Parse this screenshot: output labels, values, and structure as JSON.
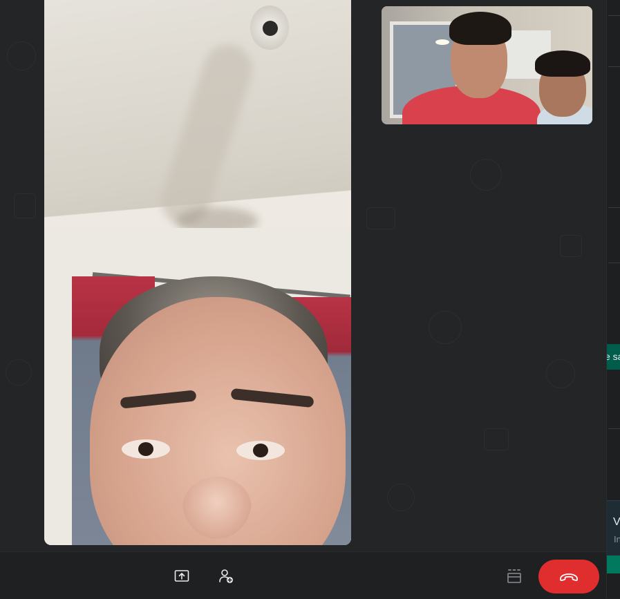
{
  "call": {
    "remote_video_label": "",
    "self_video_label": ""
  },
  "controls": {
    "share_screen_icon": "share-screen-icon",
    "add_participant_icon": "add-participant-icon",
    "layout_icon": "layout-icon",
    "end_call_icon": "end-call-icon"
  },
  "chat_edge": {
    "bubble_one_text": "e sa",
    "bubble_two_title": "V",
    "bubble_two_sub": "In"
  },
  "colors": {
    "background": "#222325",
    "end_call": "#e02d2d",
    "chat_bubble_green": "#005c4b"
  }
}
